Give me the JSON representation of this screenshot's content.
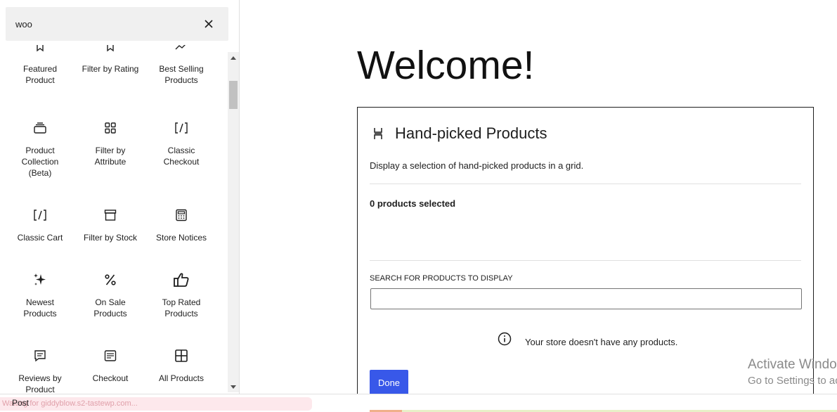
{
  "search": {
    "value": "woo"
  },
  "blocks": [
    {
      "label": "Featured\nProduct",
      "icon": "star-icon"
    },
    {
      "label": "Filter by Rating",
      "icon": "star-icon"
    },
    {
      "label": "Best Selling\nProducts",
      "icon": "trending-icon"
    },
    {
      "label": "Product\nCollection\n(Beta)",
      "icon": "stack-icon"
    },
    {
      "label": "Filter by\nAttribute",
      "icon": "grid-icon"
    },
    {
      "label": "Classic\nCheckout",
      "icon": "shortcode-icon"
    },
    {
      "label": "Classic Cart",
      "icon": "shortcode-icon"
    },
    {
      "label": "Filter by Stock",
      "icon": "archive-icon"
    },
    {
      "label": "Store Notices",
      "icon": "calculator-icon"
    },
    {
      "label": "Newest\nProducts",
      "icon": "sparkle-icon"
    },
    {
      "label": "On Sale\nProducts",
      "icon": "percent-icon"
    },
    {
      "label": "Top Rated\nProducts",
      "icon": "thumbs-up-icon"
    },
    {
      "label": "Reviews by\nProduct",
      "icon": "comment-icon"
    },
    {
      "label": "Checkout",
      "icon": "receipt-icon"
    },
    {
      "label": "All Products",
      "icon": "layout-grid-icon"
    }
  ],
  "canvas": {
    "heading": "Welcome!",
    "block": {
      "title": "Hand-picked Products",
      "description": "Display a selection of hand-picked products in a grid.",
      "selected_count": "0 products selected",
      "search_label": "SEARCH FOR PRODUCTS TO DISPLAY",
      "notice": "Your store doesn't have any products.",
      "done_label": "Done"
    }
  },
  "watermark": {
    "line1": "Activate Windows",
    "line2": "Go to Settings to activate Windows."
  },
  "footer": {
    "breadcrumb": "Post",
    "status_url": "Waiting for giddyblow.s2-tastewp.com..."
  },
  "colors": {
    "primary": "#3858e9",
    "panel_bg": "#f0f0f0"
  }
}
